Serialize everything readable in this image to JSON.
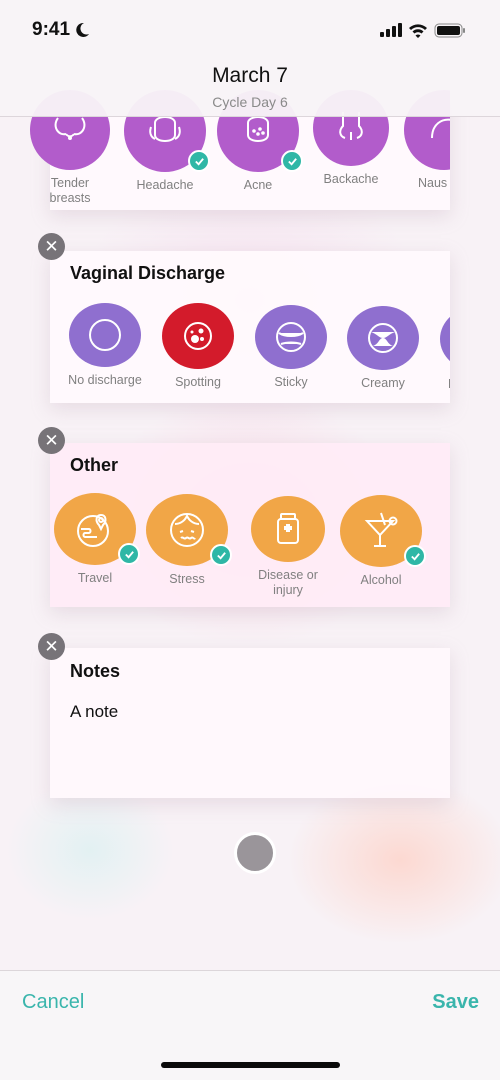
{
  "status_bar": {
    "time": "9:41"
  },
  "header": {
    "title": "March 7",
    "subtitle": "Cycle Day 6"
  },
  "symptoms_card": {
    "items": [
      {
        "label_line1": "Tender",
        "label_line2": "breasts",
        "icon": "tender-breasts-icon",
        "selected": false
      },
      {
        "label_line1": "Headache",
        "icon": "headache-icon",
        "selected": true
      },
      {
        "label_line1": "Acne",
        "icon": "acne-icon",
        "selected": true
      },
      {
        "label_line1": "Backache",
        "icon": "backache-icon",
        "selected": false
      },
      {
        "label_line1": "Naus",
        "icon": "nausea-icon",
        "selected": false
      }
    ]
  },
  "discharge_card": {
    "title": "Vaginal Discharge",
    "items": [
      {
        "label": "No discharge",
        "icon": "no-discharge-icon",
        "selected": false
      },
      {
        "label": "Spotting",
        "icon": "spotting-icon",
        "selected": true
      },
      {
        "label": "Sticky",
        "icon": "sticky-icon",
        "selected": false
      },
      {
        "label": "Creamy",
        "icon": "creamy-icon",
        "selected": false
      },
      {
        "label": "E",
        "icon": "egg-white-icon",
        "selected": false
      }
    ]
  },
  "other_card": {
    "title": "Other",
    "items": [
      {
        "label_line1": "Travel",
        "icon": "travel-icon",
        "selected": true
      },
      {
        "label_line1": "Stress",
        "icon": "stress-icon",
        "selected": true
      },
      {
        "label_line1": "Disease or",
        "label_line2": "injury",
        "icon": "disease-injury-icon",
        "selected": false
      },
      {
        "label_line1": "Alcohol",
        "icon": "alcohol-icon",
        "selected": true
      }
    ]
  },
  "notes_card": {
    "title": "Notes",
    "text": "A note"
  },
  "bottom_bar": {
    "cancel_label": "Cancel",
    "save_label": "Save"
  },
  "colors": {
    "accent": "#3ab5ac",
    "symptom_purple": "#b25ccb",
    "discharge_lavender": "#8f6fcf",
    "spotting_red": "#d31b2b",
    "other_orange": "#f1a647",
    "check_teal": "#2fb7a6"
  }
}
